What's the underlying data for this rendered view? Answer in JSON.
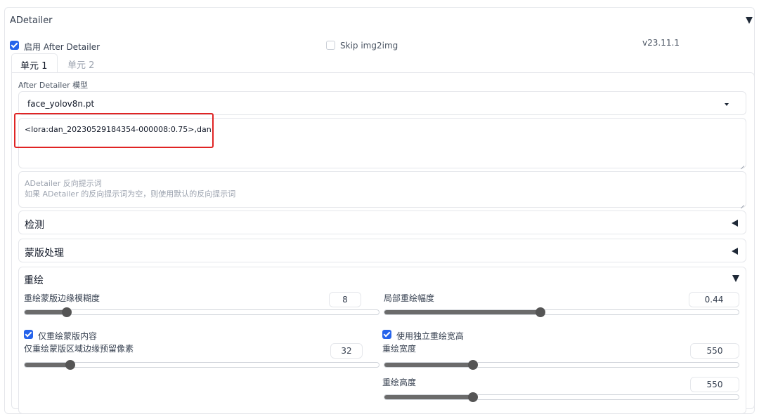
{
  "adetailer": {
    "title": "ADetailer",
    "enable_label": "启用 After Detailer",
    "enable_checked": true,
    "skip_label": "Skip img2img",
    "skip_checked": false,
    "version": "v23.11.1",
    "tabs": [
      {
        "label": "单元 1",
        "active": true
      },
      {
        "label": "单元 2",
        "active": false
      }
    ],
    "model_label": "After Detailer 模型",
    "model_value": "face_yolov8n.pt",
    "prompt_value": "<lora:dan_20230529184354-000008:0.75>,dan",
    "neg_placeholder_line1": "ADetailer 反向提示词",
    "neg_placeholder_line2": "如果 ADetailer 的反向提示词为空，则使用默认的反向提示词",
    "sections": {
      "detect": "检测",
      "mask": "蒙版处理",
      "inpaint": "重绘"
    },
    "inpaint": {
      "mask_blur_label": "重绘蒙版边缘模糊度",
      "mask_blur_value": "8",
      "mask_blur_fraction": 0.12,
      "denoise_label": "局部重绘幅度",
      "denoise_value": "0.44",
      "denoise_fraction": 0.44,
      "only_masked_label": "仅重绘蒙版内容",
      "only_masked_checked": true,
      "use_sep_wh_label": "使用独立重绘宽高",
      "use_sep_wh_checked": true,
      "padding_label": "仅重绘蒙版区域边缘预留像素",
      "padding_value": "32",
      "padding_fraction": 0.13,
      "width_label": "重绘宽度",
      "width_value": "550",
      "width_fraction": 0.25,
      "height_label": "重绘高度",
      "height_value": "550",
      "height_fraction": 0.25
    },
    "highlight_color": "#e02424",
    "accent_color": "#2563eb"
  }
}
